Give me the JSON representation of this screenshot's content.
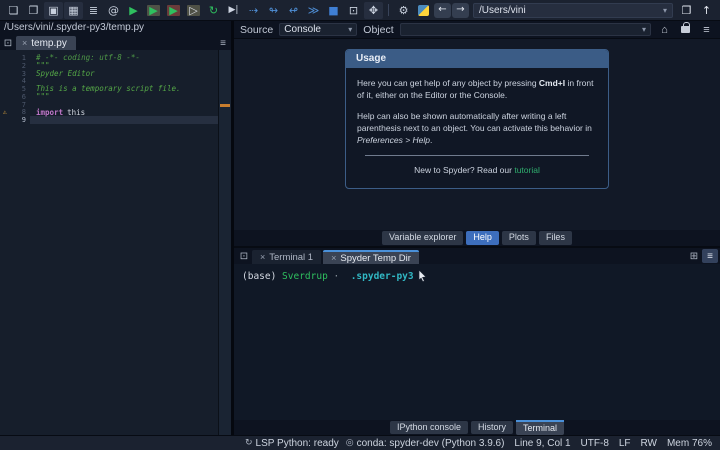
{
  "colors": {
    "accent_blue": "#4a90d9",
    "usage_header_blue": "#3b5c86",
    "link_green": "#2fae6e",
    "warning_orange": "#e2a63d",
    "comment_green": "#55a847",
    "keyword_purple": "#c077c9",
    "run_green": "#2fbf5f",
    "debug_blue": "#4f8fd6",
    "terminal_host_green": "#2fbf5f",
    "terminal_dir_teal": "#31b8c4"
  },
  "toolbar": {
    "left_icons": [
      {
        "name": "new-file-icon",
        "glyph": "❏",
        "color": "#c9d1de"
      },
      {
        "name": "open-file-icon",
        "glyph": "❐",
        "color": "#c9d1de"
      },
      {
        "name": "save-file-icon",
        "glyph": "▣",
        "color": "#c9d1de",
        "cls": "boxed"
      },
      {
        "name": "save-all-icon",
        "glyph": "▦",
        "color": "#c9d1de",
        "cls": "boxed"
      },
      {
        "name": "file-switcher-icon",
        "glyph": "≣",
        "color": "#c9d1de"
      },
      {
        "name": "symbol-finder-icon",
        "glyph": "@",
        "color": "#c9d1de"
      },
      {
        "name": "run-file-icon",
        "glyph": "▶",
        "color": "#2fbf5f"
      },
      {
        "name": "run-cell-icon",
        "glyph": "▶",
        "color": "#2fbf5f",
        "cls": "cellbox"
      },
      {
        "name": "run-cell-advance-icon",
        "glyph": "▶",
        "color": "#2fbf5f",
        "cls": "cellbox-red"
      },
      {
        "name": "rerun-cell-icon",
        "glyph": "▷",
        "color": "#d8dde6",
        "cls": "cellbox"
      },
      {
        "name": "rerun-last-icon",
        "glyph": "↻",
        "color": "#2fbf5f"
      },
      {
        "name": "run-to-line-icon",
        "glyph": "▶|",
        "color": "#cfd6e2",
        "cls": "smallglyph"
      },
      {
        "name": "debug-step-icon",
        "glyph": "⇢",
        "color": "#4f8fd6"
      },
      {
        "name": "debug-step-into-icon",
        "glyph": "↬",
        "color": "#4f8fd6"
      },
      {
        "name": "debug-step-out-icon",
        "glyph": "↫",
        "color": "#4f8fd6"
      },
      {
        "name": "debug-continue-icon",
        "glyph": "≫",
        "color": "#4f8fd6"
      },
      {
        "name": "debug-stop-icon",
        "glyph": "■",
        "color": "#3f7fd4"
      },
      {
        "name": "panes-layout-icon",
        "glyph": "⊡",
        "color": "#c9d1de"
      },
      {
        "name": "maximize-pane-icon",
        "glyph": "✥",
        "color": "#c9d1de",
        "cls": "boxed"
      }
    ],
    "tool_icons": [
      {
        "name": "tools-icon",
        "glyph": "⚙",
        "color": "#c9d1de"
      },
      {
        "name": "python-env-icon",
        "glyph": "",
        "cls": "python"
      }
    ],
    "nav_icons": [
      {
        "name": "back-icon",
        "glyph": "←",
        "color": "#e3e8f0",
        "cls": "navbtn"
      },
      {
        "name": "forward-icon",
        "glyph": "→",
        "color": "#e3e8f0",
        "cls": "navbtn"
      }
    ],
    "path_value": "/Users/vini",
    "dropdown_caret": "▾",
    "trail_icons": [
      {
        "name": "open-dir-icon",
        "glyph": "❐",
        "color": "#e3e8f0"
      },
      {
        "name": "up-dir-icon",
        "glyph": "↑",
        "color": "#e3e8f0"
      }
    ]
  },
  "editor": {
    "file_path": "/Users/vini/.spyder-py3/temp.py",
    "browse_icon": "⊡",
    "tab_label": "temp.py",
    "tab_close": "×",
    "menu_icon": "≡",
    "gutter": [
      {
        "name": "line-number",
        "n": "1",
        "warn": ""
      },
      {
        "name": "line-number",
        "n": "2",
        "warn": ""
      },
      {
        "name": "line-number",
        "n": "3",
        "warn": ""
      },
      {
        "name": "line-number",
        "n": "4",
        "warn": ""
      },
      {
        "name": "line-number",
        "n": "5",
        "warn": ""
      },
      {
        "name": "line-number",
        "n": "6",
        "warn": ""
      },
      {
        "name": "line-number",
        "n": "7",
        "warn": ""
      },
      {
        "name": "line-number-warning",
        "n": "8",
        "warn": "⚠"
      },
      {
        "name": "line-number-current",
        "n": "9",
        "warn": "",
        "cls": "current"
      }
    ],
    "code": {
      "line1": "# -*- coding: utf-8 -*-",
      "doc_open": "\"\"\"",
      "line3": "Spyder Editor",
      "line5": "This is a temporary script file.",
      "doc_close": "\"\"\"",
      "import_kw": "import",
      "import_arg": "this"
    }
  },
  "help": {
    "source_label": "Source",
    "source_value": "Console",
    "object_label": "Object",
    "object_value": "",
    "home_icon": "⌂",
    "menu_icon": "≡",
    "usage": {
      "title": "Usage",
      "para1_prefix": "Here you can get help of any object by pressing ",
      "para1_kbd": "Cmd+I",
      "para1_suffix": " in front of it, either on the Editor or the Console.",
      "para2_prefix": "Help can also be shown automatically after writing a left parenthesis next to an object. You can activate this behavior in ",
      "para2_em": "Preferences > Help",
      "para2_suffix": ".",
      "footer_text": "New to Spyder? Read our ",
      "footer_link": "tutorial"
    },
    "tabs": [
      {
        "name": "tab-variable-explorer",
        "label": "Variable explorer",
        "active": false
      },
      {
        "name": "tab-help",
        "label": "Help",
        "active": true
      },
      {
        "name": "tab-plots",
        "label": "Plots",
        "active": false
      },
      {
        "name": "tab-files",
        "label": "Files",
        "active": false
      }
    ]
  },
  "terminal": {
    "browse_icon": "⊡",
    "grid_icon": "⊞",
    "menu_icon": "≡",
    "tabs": [
      {
        "name": "tab-terminal-1",
        "label": "Terminal 1",
        "close": "×",
        "active": false
      },
      {
        "name": "tab-spyder-temp-dir",
        "label": "Spyder Temp Dir",
        "close": "×",
        "active": true
      }
    ],
    "prompt": {
      "env": "(base) ",
      "host": "Sverdrup",
      "sep": " · ",
      "dir": " .spyder-py3"
    },
    "bottom_tabs": [
      {
        "name": "tab-ipython-console",
        "label": "IPython console",
        "active": false
      },
      {
        "name": "tab-history",
        "label": "History",
        "active": false
      },
      {
        "name": "tab-terminal",
        "label": "Terminal",
        "active": true
      }
    ]
  },
  "statusbar": {
    "items": [
      {
        "name": "lsp-status",
        "icon": "↻",
        "label": "LSP Python: ready"
      },
      {
        "name": "conda-status",
        "icon": "◎",
        "label": "conda: spyder-dev (Python 3.9.6)"
      },
      {
        "name": "cursor-position",
        "icon": "",
        "label": "Line 9, Col 1"
      },
      {
        "name": "encoding-status",
        "icon": "",
        "label": "UTF-8"
      },
      {
        "name": "eol-status",
        "icon": "",
        "label": "LF"
      },
      {
        "name": "permissions-status",
        "icon": "",
        "label": "RW"
      },
      {
        "name": "memory-status",
        "icon": "",
        "label": "Mem 76%"
      }
    ]
  }
}
